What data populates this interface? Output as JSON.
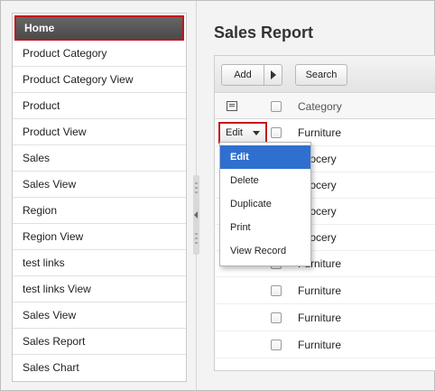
{
  "sidebar": {
    "home_label": "Home",
    "items": [
      {
        "label": "Product Category"
      },
      {
        "label": "Product Category View"
      },
      {
        "label": "Product"
      },
      {
        "label": "Product View"
      },
      {
        "label": "Sales"
      },
      {
        "label": "Sales View"
      },
      {
        "label": "Region"
      },
      {
        "label": "Region View"
      },
      {
        "label": "test links"
      },
      {
        "label": "test links View"
      },
      {
        "label": "Sales View"
      },
      {
        "label": "Sales Report"
      },
      {
        "label": "Sales Chart"
      }
    ]
  },
  "main": {
    "title": "Sales Report",
    "toolbar": {
      "add_label": "Add",
      "search_label": "Search"
    },
    "grid": {
      "column_header": "Category",
      "edit_label": "Edit",
      "rows": [
        {
          "category": "Furniture"
        },
        {
          "category": "Grocery"
        },
        {
          "category": "Grocery"
        },
        {
          "category": "Grocery"
        },
        {
          "category": "Grocery"
        },
        {
          "category": "Furniture"
        },
        {
          "category": "Furniture"
        },
        {
          "category": "Furniture"
        },
        {
          "category": "Furniture"
        }
      ]
    },
    "edit_menu": {
      "items": [
        {
          "label": "Edit"
        },
        {
          "label": "Delete"
        },
        {
          "label": "Duplicate"
        },
        {
          "label": "Print"
        },
        {
          "label": "View Record"
        }
      ]
    }
  },
  "colors": {
    "highlight_border": "#c4161c",
    "menu_active": "#2f6fcf",
    "home_bg": "#555555"
  },
  "icons": [
    "column-chooser-icon",
    "triangle-right-icon",
    "triangle-down-icon",
    "collapse-arrow-icon"
  ]
}
